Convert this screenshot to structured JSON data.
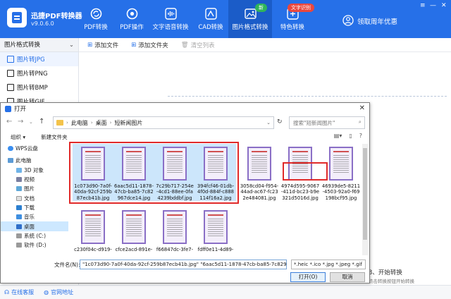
{
  "app": {
    "title": "迅捷PDF转换器",
    "version": "v9.0.6.0",
    "accent_color": "#2670e8",
    "nav": [
      {
        "label": "PDF转换",
        "icon": "refresh-icon"
      },
      {
        "label": "PDF操作",
        "icon": "pdf-gear-icon"
      },
      {
        "label": "文字语音转换",
        "icon": "audio-wave-icon"
      },
      {
        "label": "CAD转换",
        "icon": "cad-icon"
      },
      {
        "label": "图片格式转换",
        "icon": "image-icon",
        "badge": "新"
      },
      {
        "label": "特色转换",
        "icon": "special-convert-icon",
        "badge": "文字识别"
      }
    ],
    "member_label": "领取周年优惠"
  },
  "sidebar": {
    "title": "图片格式转换",
    "items": [
      "图片转JPG",
      "图片转PNG",
      "图片转BMP",
      "图片转GIF"
    ]
  },
  "toolbar": {
    "add_file": "添加文件",
    "add_folder": "添加文件夹",
    "clear_list": "清空列表"
  },
  "steps": {
    "step3": "3、开始转换",
    "step3_sub": "点击转换按钮开始转换"
  },
  "footer": {
    "online_support": "在线客服",
    "website": "官网地址"
  },
  "dialog": {
    "title": "打开",
    "breadcrumb": [
      "此电脑",
      "桌面",
      "短新闻图片"
    ],
    "search_placeholder": "搜索\"短新闻图片\"",
    "organize": "组织 ▾",
    "new_folder": "新建文件夹",
    "tree": [
      "WPS云盘",
      "此电脑",
      "3D 对象",
      "视频",
      "图片",
      "文档",
      "下载",
      "音乐",
      "桌面",
      "系统 (C:)",
      "软件 (D:)"
    ],
    "files": [
      {
        "name": "1c073d90-7a0f-40da-92cf-259b87ecb41b.jpg",
        "selected": true
      },
      {
        "name": "6aac5d11-1878-47cb-ba85-7c82967dce14.jpg",
        "selected": true
      },
      {
        "name": "7c29b717-254e-4cd1-88ee-0fa4239bddbf.jpg",
        "selected": true
      },
      {
        "name": "394fcf46-01db-4f0d-884f-c888114f16a2.jpg",
        "selected": true
      },
      {
        "name": "3058cd04-f954-44ad-ac67-fc232e484081.jpg",
        "selected": false
      },
      {
        "name": "4974d595-9067-411d-bc23-b9e321d5016d.jpg",
        "selected": false
      },
      {
        "name": "46939de5-8211-4503-92a0-f69198bcf95.jpg",
        "selected": false
      },
      {
        "name": "c230f04c-d919-",
        "selected": false
      },
      {
        "name": "cfce2acd-891e-",
        "selected": false
      },
      {
        "name": "f66847dc-3fe7-",
        "selected": false
      },
      {
        "name": "fdff0e11-4d89-",
        "selected": false
      }
    ],
    "filename_label": "文件名(N):",
    "filename_value": "\"1c073d90-7a0f-40da-92cf-259b87ecb41b.jpg\" \"6aac5d11-1878-47cb-ba85-7c82967dce",
    "filetype_value": "*.heic *.ico *.jpg *.jpeg *.gif",
    "open_button": "打开(O)",
    "cancel_button": "取消"
  }
}
